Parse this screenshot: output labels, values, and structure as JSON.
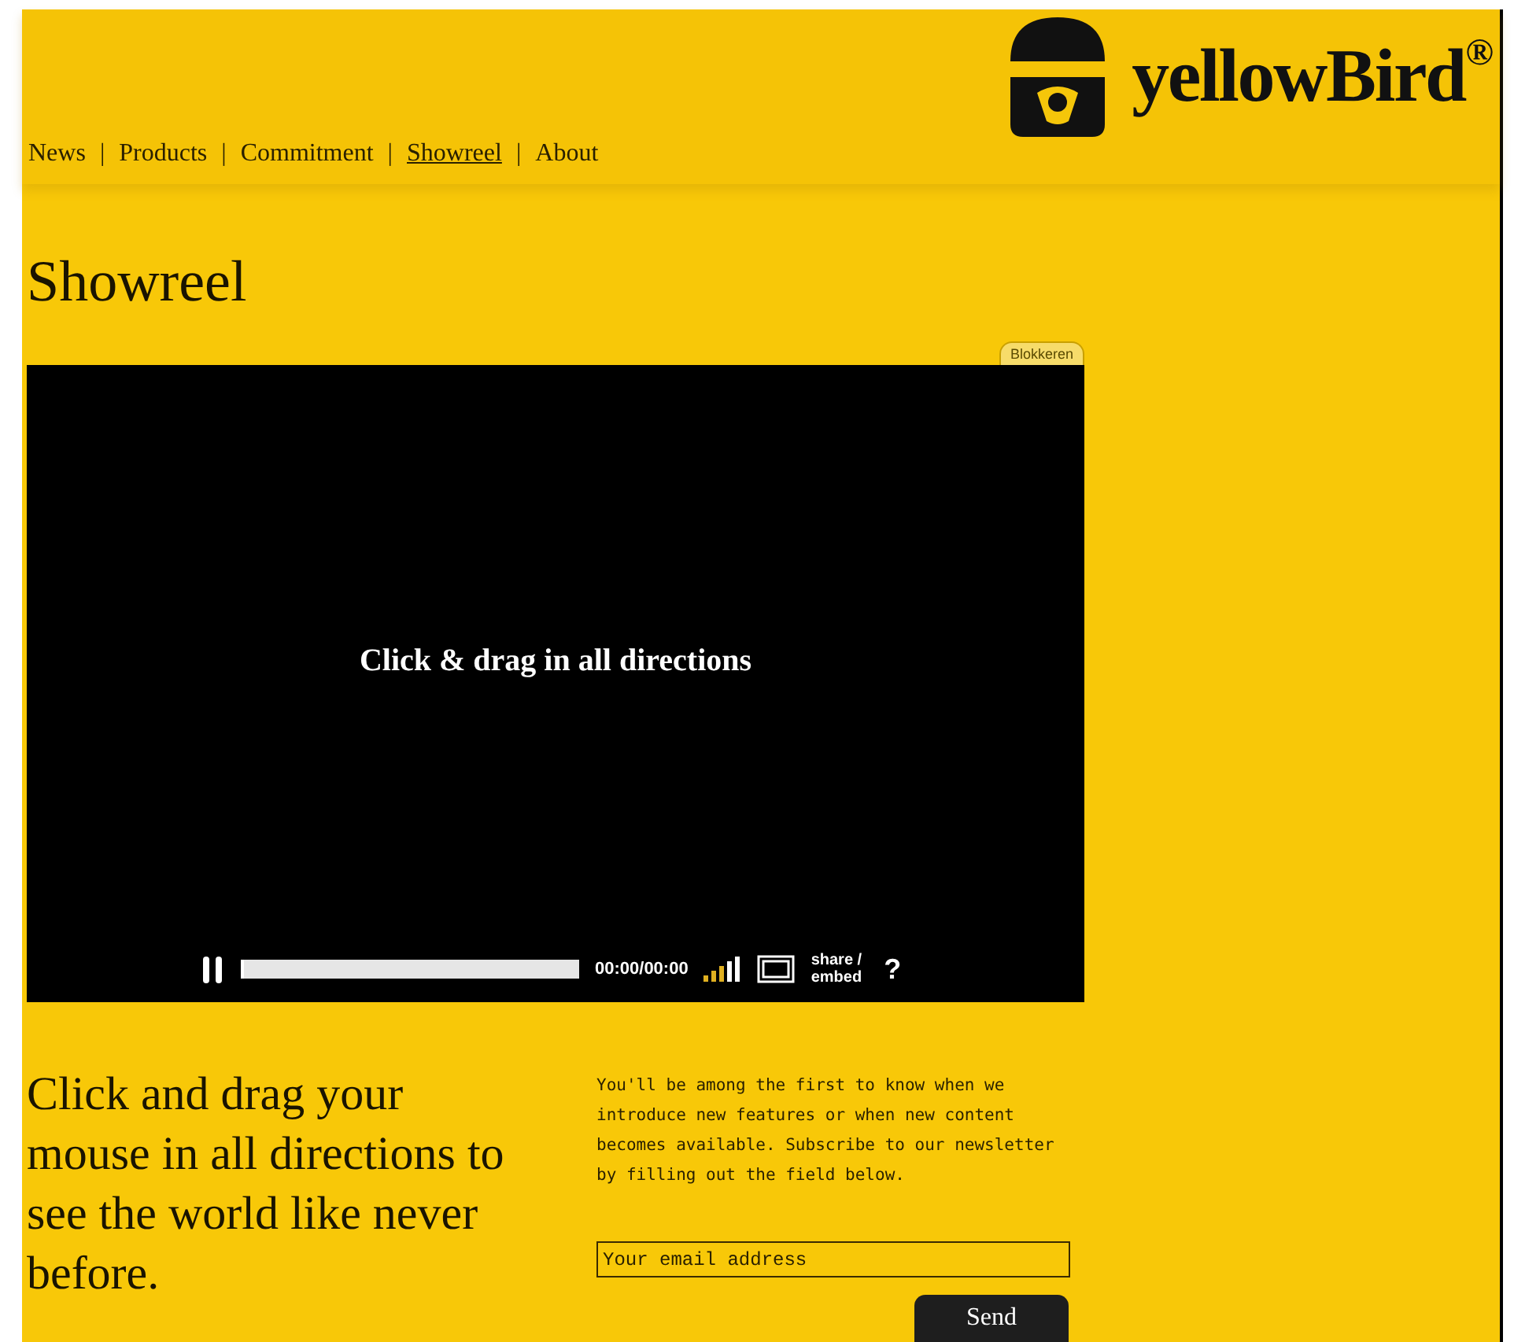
{
  "logo": {
    "text": "yellowBird",
    "mark": "®"
  },
  "nav_separator": "|",
  "nav": [
    {
      "label": "News",
      "selected": false
    },
    {
      "label": "Products",
      "selected": false
    },
    {
      "label": "Commitment",
      "selected": false
    },
    {
      "label": "Showreel",
      "selected": true
    },
    {
      "label": "About",
      "selected": false
    }
  ],
  "page_title": "Showreel",
  "video": {
    "block_tab": "Blokkeren",
    "overlay_text": "Click & drag in all directions",
    "playing": true,
    "progress": {
      "level": 0.01
    },
    "time": "00:00/00:00",
    "share_label": [
      "share /",
      "embed"
    ],
    "help": "?"
  },
  "tagline": "Click and drag your mouse in all directions to see the world like never before.",
  "newsletter": {
    "text": "You'll be among the first to know when we introduce new features or when new content becomes available. Subscribe to our newsletter by filling out the field below.",
    "email": {
      "placeholder": "Your email address"
    },
    "button": "Send"
  }
}
